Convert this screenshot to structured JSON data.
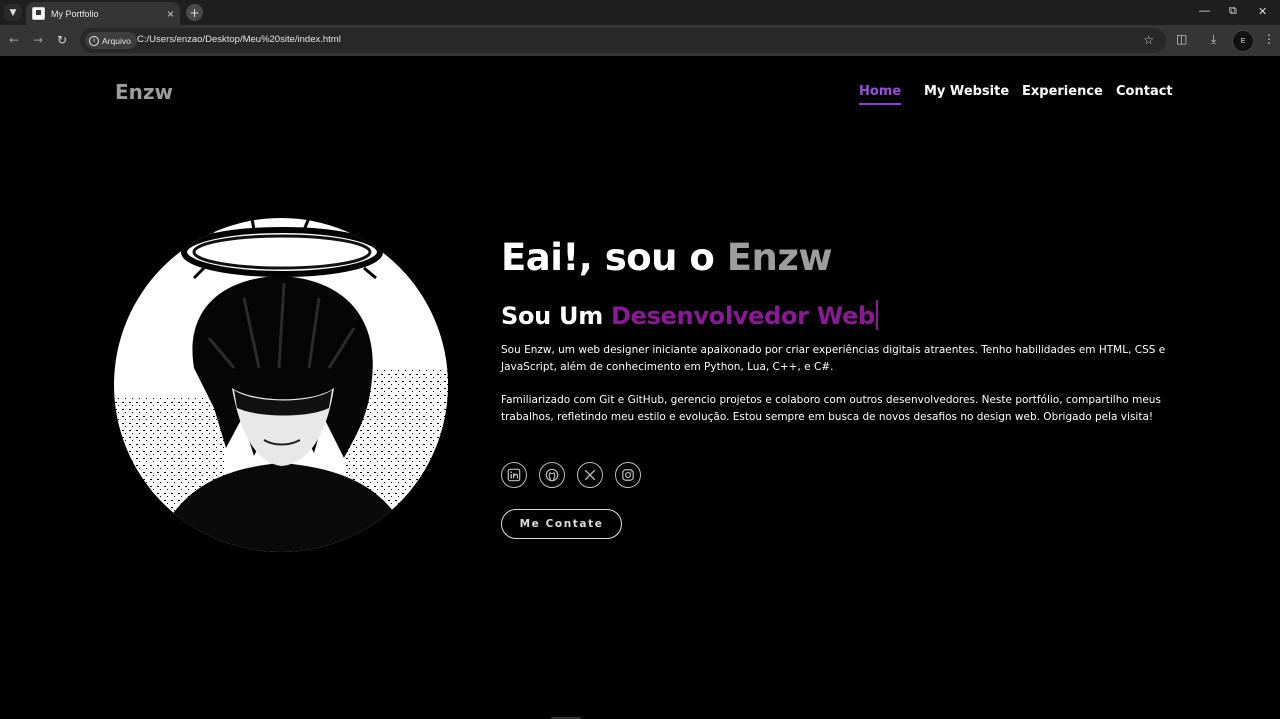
{
  "browser": {
    "tab_title": "My Portfolio",
    "chip_label": "Arquivo",
    "url": "C:/Users/enzao/Desktop/Meu%20site/index.html",
    "profile_initial": "E",
    "icons": [
      "tab-search-icon",
      "favicon-icon",
      "close-icon",
      "plus-icon",
      "minimize-icon",
      "restore-icon",
      "window-close-icon",
      "back-icon",
      "forward-icon",
      "reload-icon",
      "info-icon",
      "star-icon",
      "extensions-icon",
      "download-icon",
      "menu-icon"
    ]
  },
  "site": {
    "logo": "Enzw",
    "nav": [
      {
        "label": "Home",
        "active": true
      },
      {
        "label": "My Website",
        "active": false
      },
      {
        "label": "Experience",
        "active": false
      },
      {
        "label": "Contact",
        "active": false
      }
    ],
    "hero": {
      "greeting": "Eai!, sou o ",
      "name": "Enzw",
      "role_prefix": "Sou Um ",
      "role": "Desenvolvedor Web",
      "paragraph1": "Sou Enzw, um web designer iniciante apaixonado por criar experiências digitais atraentes. Tenho habilidades em HTML, CSS e JavaScript, além de conhecimento em Python, Lua, C++, e C#.",
      "paragraph2": "Familiarizado com Git e GitHub, gerencio projetos e colaboro com outros desenvolvedores. Neste portfólio, compartilho meus trabalhos, refletindo meu estilo e evolução. Estou sempre em busca de novos desafios no design web. Obrigado pela visita!",
      "socials": [
        "linkedin-icon",
        "github-icon",
        "x-icon",
        "instagram-icon"
      ],
      "cta": "Me Contate"
    },
    "colors": {
      "accent": "#8a1a94",
      "nav_active": "#9b4dde",
      "logo": "#9d9d9d",
      "background": "#000000"
    }
  }
}
